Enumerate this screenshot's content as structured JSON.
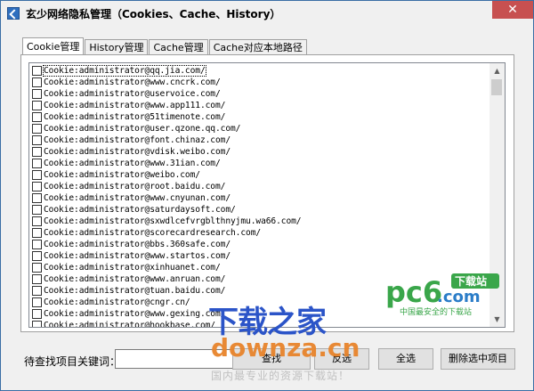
{
  "window": {
    "title": "玄少网络隐私管理（Cookies、Cache、History）",
    "close_glyph": "✕"
  },
  "tabs": [
    {
      "label": "Cookie管理"
    },
    {
      "label": "History管理"
    },
    {
      "label": "Cache管理"
    },
    {
      "label": "Cache对应本地路径"
    }
  ],
  "cookies": [
    "Cookie:administrator@qq.jia.com/",
    "Cookie:administrator@www.cncrk.com/",
    "Cookie:administrator@uservoice.com/",
    "Cookie:administrator@www.app111.com/",
    "Cookie:administrator@51timenote.com/",
    "Cookie:administrator@user.qzone.qq.com/",
    "Cookie:administrator@font.chinaz.com/",
    "Cookie:administrator@vdisk.weibo.com/",
    "Cookie:administrator@www.31ian.com/",
    "Cookie:administrator@weibo.com/",
    "Cookie:administrator@root.baidu.com/",
    "Cookie:administrator@www.cnyunan.com/",
    "Cookie:administrator@saturdaysoft.com/",
    "Cookie:administrator@sxwdlcefvrgblthnyjmu.wa66.com/",
    "Cookie:administrator@scorecardresearch.com/",
    "Cookie:administrator@bbs.360safe.com/",
    "Cookie:administrator@www.startos.com/",
    "Cookie:administrator@xinhuanet.com/",
    "Cookie:administrator@www.anruan.com/",
    "Cookie:administrator@tuan.baidu.com/",
    "Cookie:administrator@cngr.cn/",
    "Cookie:administrator@www.gexing.com/",
    "Cookie:administrator@hookbase.com/"
  ],
  "bottom": {
    "search_label": "待查找项目关键词：",
    "search_value": "",
    "find_button": "查找",
    "invert_button": "反选",
    "select_all_button": "全选",
    "delete_button": "删除选中项目"
  },
  "watermark": {
    "logo_text": "pc6",
    "logo_sub": ".com",
    "logo_badge": "下载站",
    "logo_slogan": "中国最安全的下载站",
    "brand_cn": "下载之家",
    "brand_url": "downza.cn",
    "brand_tag": "国内最专业的资源下载站！"
  },
  "colors": {
    "accent": "#2b54c8",
    "close": "#c75050",
    "watermark_orange": "#e8842b",
    "pc6_green": "#3aa64a"
  }
}
